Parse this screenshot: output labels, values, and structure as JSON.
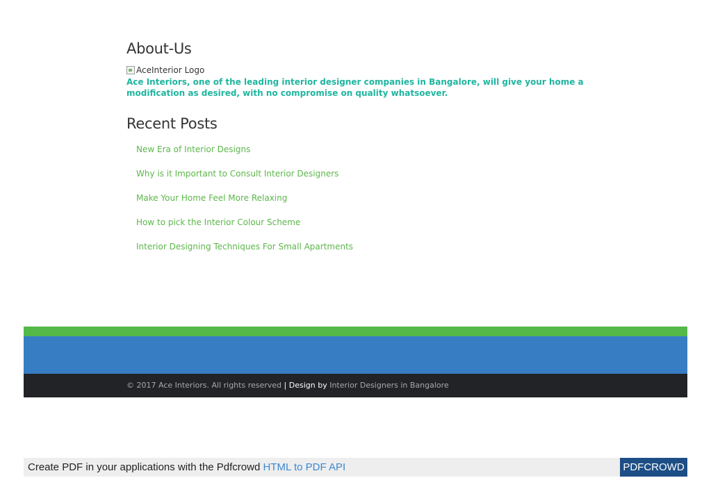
{
  "about": {
    "title": "About-Us",
    "logo_alt": "AceInterior Logo",
    "description": "Ace Interiors, one of the leading interior designer companies in Bangalore, will give your home a modification as desired, with no compromise on quality whatsoever."
  },
  "recent_posts": {
    "title": "Recent Posts",
    "items": [
      {
        "label": "New Era of Interior Designs"
      },
      {
        "label": "Why is it Important to Consult Interior Designers"
      },
      {
        "label": "Make Your Home Feel More Relaxing"
      },
      {
        "label": "How to pick the Interior Colour Scheme"
      },
      {
        "label": "Interior Designing Techniques For Small Apartments"
      }
    ]
  },
  "footer": {
    "copyright": "© 2017 Ace Interiors. All rights reserved",
    "separator": "|",
    "design_by": "Design by",
    "design_link": "Interior Designers in Bangalore"
  },
  "pdfcrowd": {
    "text": "Create PDF in your applications with the Pdfcrowd",
    "link": "HTML to PDF API",
    "badge": "PDFCROWD"
  },
  "colors": {
    "about_text": "#1fb5a0",
    "post_link": "#5cb64a",
    "band_green": "#55b949",
    "band_blue": "#377dc3",
    "band_dark": "#222326",
    "pdf_badge": "#1d4f86"
  }
}
